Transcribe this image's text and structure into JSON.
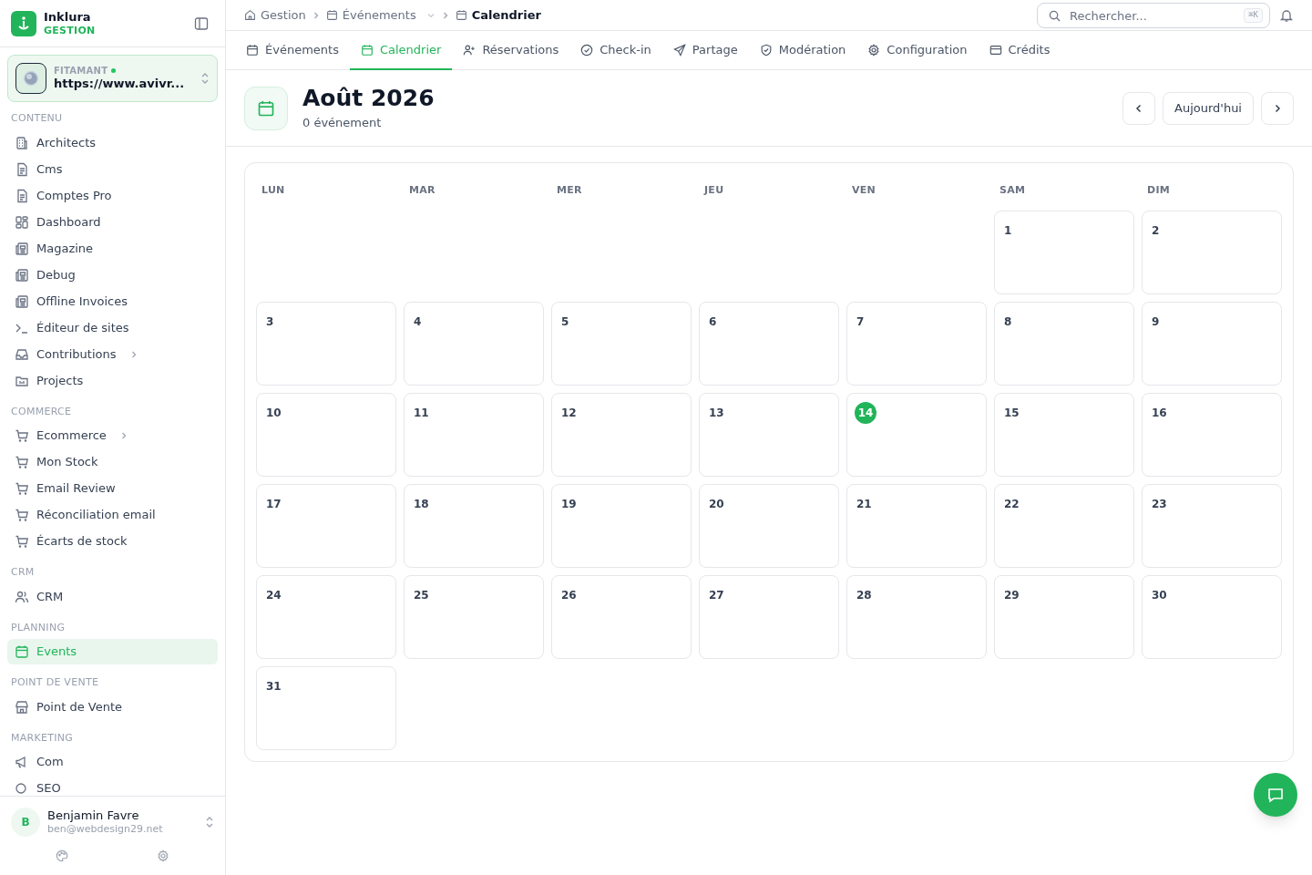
{
  "brand": {
    "name": "Inklura",
    "subtitle": "GESTION"
  },
  "workspace": {
    "label": "FITAMANT",
    "online": true,
    "url": "https://www.avivr..."
  },
  "sidebar": {
    "sections": [
      {
        "title": "CONTENU",
        "items": [
          {
            "label": "Architects",
            "selected": false,
            "has_children": false
          },
          {
            "label": "Cms",
            "selected": false,
            "has_children": false
          },
          {
            "label": "Comptes Pro",
            "selected": false,
            "has_children": false
          },
          {
            "label": "Dashboard",
            "selected": false,
            "has_children": false
          },
          {
            "label": "Magazine",
            "selected": false,
            "has_children": false
          },
          {
            "label": "Debug",
            "selected": false,
            "has_children": false
          },
          {
            "label": "Offline Invoices",
            "selected": false,
            "has_children": false
          },
          {
            "label": "Éditeur de sites",
            "selected": false,
            "has_children": false
          },
          {
            "label": "Contributions",
            "selected": false,
            "has_children": true
          },
          {
            "label": "Projects",
            "selected": false,
            "has_children": false
          }
        ]
      },
      {
        "title": "COMMERCE",
        "items": [
          {
            "label": "Ecommerce",
            "selected": false,
            "has_children": true
          },
          {
            "label": "Mon Stock",
            "selected": false,
            "has_children": false
          },
          {
            "label": "Email Review",
            "selected": false,
            "has_children": false
          },
          {
            "label": "Réconciliation email",
            "selected": false,
            "has_children": false
          },
          {
            "label": "Écarts de stock",
            "selected": false,
            "has_children": false
          }
        ]
      },
      {
        "title": "CRM",
        "items": [
          {
            "label": "CRM",
            "selected": false,
            "has_children": false
          }
        ]
      },
      {
        "title": "PLANNING",
        "items": [
          {
            "label": "Events",
            "selected": true,
            "has_children": false
          }
        ]
      },
      {
        "title": "POINT DE VENTE",
        "items": [
          {
            "label": "Point de Vente",
            "selected": false,
            "has_children": false
          }
        ]
      },
      {
        "title": "MARKETING",
        "items": [
          {
            "label": "Com",
            "selected": false,
            "has_children": false
          },
          {
            "label": "SEO",
            "selected": false,
            "has_children": false
          }
        ]
      }
    ]
  },
  "user": {
    "initial": "B",
    "name": "Benjamin Favre",
    "email": "ben@webdesign29.net"
  },
  "breadcrumb": [
    {
      "label": "Gestion",
      "current": false,
      "dropdown": false
    },
    {
      "label": "Événements",
      "current": false,
      "dropdown": true
    },
    {
      "label": "Calendrier",
      "current": true,
      "dropdown": false
    }
  ],
  "search": {
    "placeholder": "Rechercher...",
    "shortcut": "⌘K"
  },
  "tabs": [
    {
      "label": "Événements",
      "selected": false
    },
    {
      "label": "Calendrier",
      "selected": true
    },
    {
      "label": "Réservations",
      "selected": false
    },
    {
      "label": "Check-in",
      "selected": false
    },
    {
      "label": "Partage",
      "selected": false
    },
    {
      "label": "Modération",
      "selected": false
    },
    {
      "label": "Configuration",
      "selected": false
    },
    {
      "label": "Crédits",
      "selected": false
    }
  ],
  "header": {
    "title": "Août 2026",
    "subtitle": "0 événement",
    "today_button": "Aujourd'hui"
  },
  "calendar": {
    "weekdays": [
      "LUN",
      "MAR",
      "MER",
      "JEU",
      "VEN",
      "SAM",
      "DIM"
    ],
    "weeks": [
      [
        {
          "kind": "blank"
        },
        {
          "kind": "blank"
        },
        {
          "kind": "blank"
        },
        {
          "kind": "blank"
        },
        {
          "kind": "blank"
        },
        {
          "kind": "day",
          "day": "1",
          "today": false
        },
        {
          "kind": "day",
          "day": "2",
          "today": false
        }
      ],
      [
        {
          "day": "3",
          "today": false
        },
        {
          "day": "4",
          "today": false
        },
        {
          "day": "5",
          "today": false
        },
        {
          "day": "6",
          "today": false
        },
        {
          "day": "7",
          "today": false
        },
        {
          "day": "8",
          "today": false
        },
        {
          "day": "9",
          "today": false
        }
      ],
      [
        {
          "day": "10",
          "today": false
        },
        {
          "day": "11",
          "today": false
        },
        {
          "day": "12",
          "today": false
        },
        {
          "day": "13",
          "today": false
        },
        {
          "day": "14",
          "today": true
        },
        {
          "day": "15",
          "today": false
        },
        {
          "day": "16",
          "today": false
        }
      ],
      [
        {
          "day": "17",
          "today": false
        },
        {
          "day": "18",
          "today": false
        },
        {
          "day": "19",
          "today": false
        },
        {
          "day": "20",
          "today": false
        },
        {
          "day": "21",
          "today": false
        },
        {
          "day": "22",
          "today": false
        },
        {
          "day": "23",
          "today": false
        }
      ],
      [
        {
          "day": "24",
          "today": false
        },
        {
          "day": "25",
          "today": false
        },
        {
          "day": "26",
          "today": false
        },
        {
          "day": "27",
          "today": false
        },
        {
          "day": "28",
          "today": false
        },
        {
          "day": "29",
          "today": false
        },
        {
          "day": "30",
          "today": false
        }
      ],
      [
        {
          "kind": "day",
          "day": "31",
          "today": false
        }
      ]
    ]
  }
}
